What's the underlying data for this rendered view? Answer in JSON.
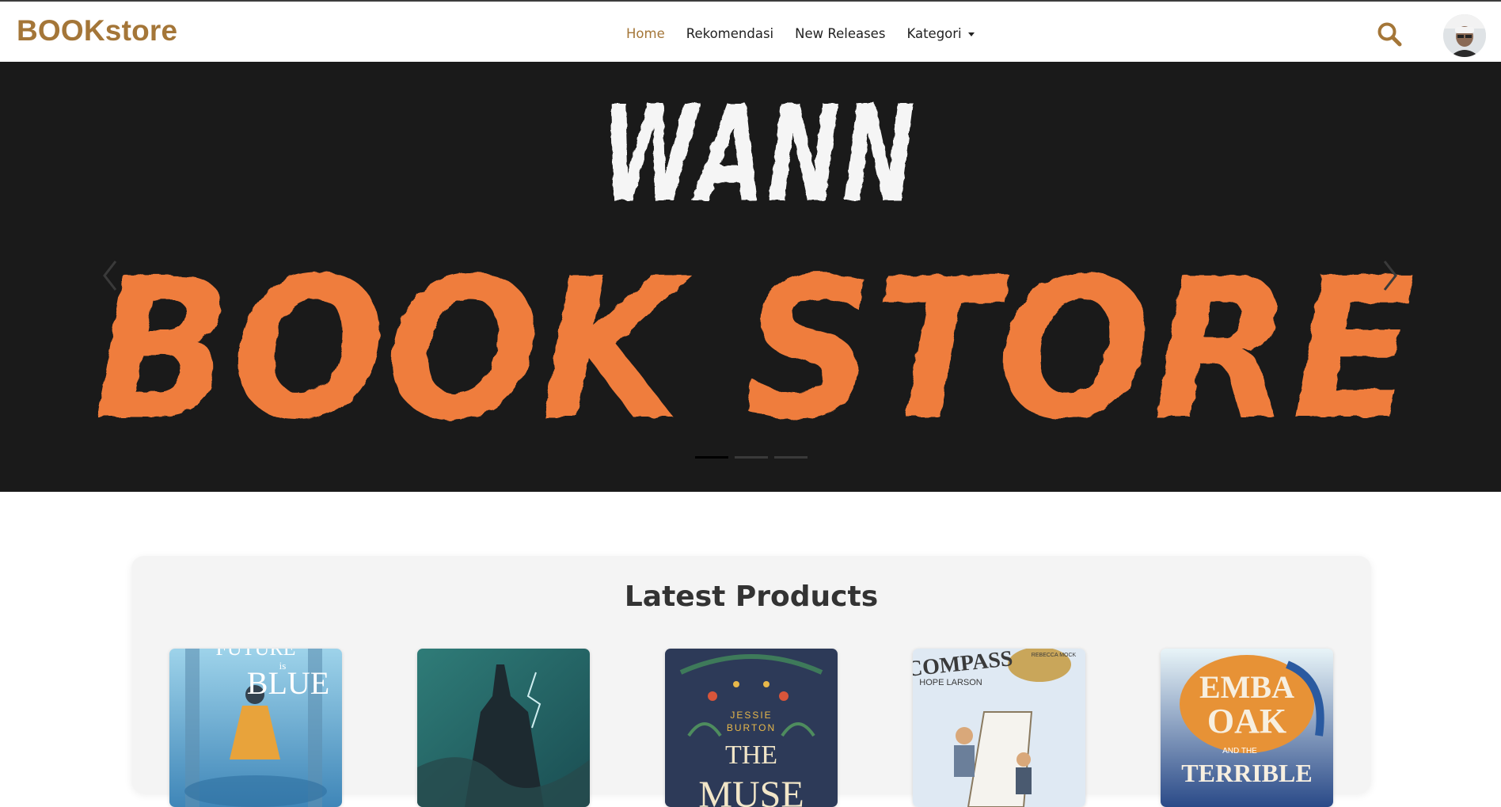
{
  "navbar": {
    "brand": "BOOKstore",
    "links": [
      {
        "label": "Home",
        "active": true
      },
      {
        "label": "Rekomendasi",
        "active": false
      },
      {
        "label": "New Releases",
        "active": false
      },
      {
        "label": "Kategori",
        "active": false
      }
    ],
    "search_icon": "search-icon",
    "accent_color": "#a47638"
  },
  "hero": {
    "line1": "WANN",
    "line2": "BOOK STORE",
    "background_color": "#1a1a1a",
    "line2_color": "#ef7d3c",
    "slide_count": 3,
    "active_slide": 1
  },
  "products": {
    "title": "Latest Products",
    "books": [
      {
        "cover_words": [
          "FUTURE",
          "is",
          "BLUE"
        ]
      },
      {
        "cover_words": []
      },
      {
        "cover_words": [
          "JESSIE",
          "BURTON",
          "THE",
          "MUSE"
        ]
      },
      {
        "cover_words": [
          "COMPASS",
          "HOPE LARSON",
          "REBECCA MOCK"
        ]
      },
      {
        "cover_words": [
          "EMBA",
          "OAK",
          "AND THE",
          "TERRIBLE"
        ]
      }
    ]
  }
}
